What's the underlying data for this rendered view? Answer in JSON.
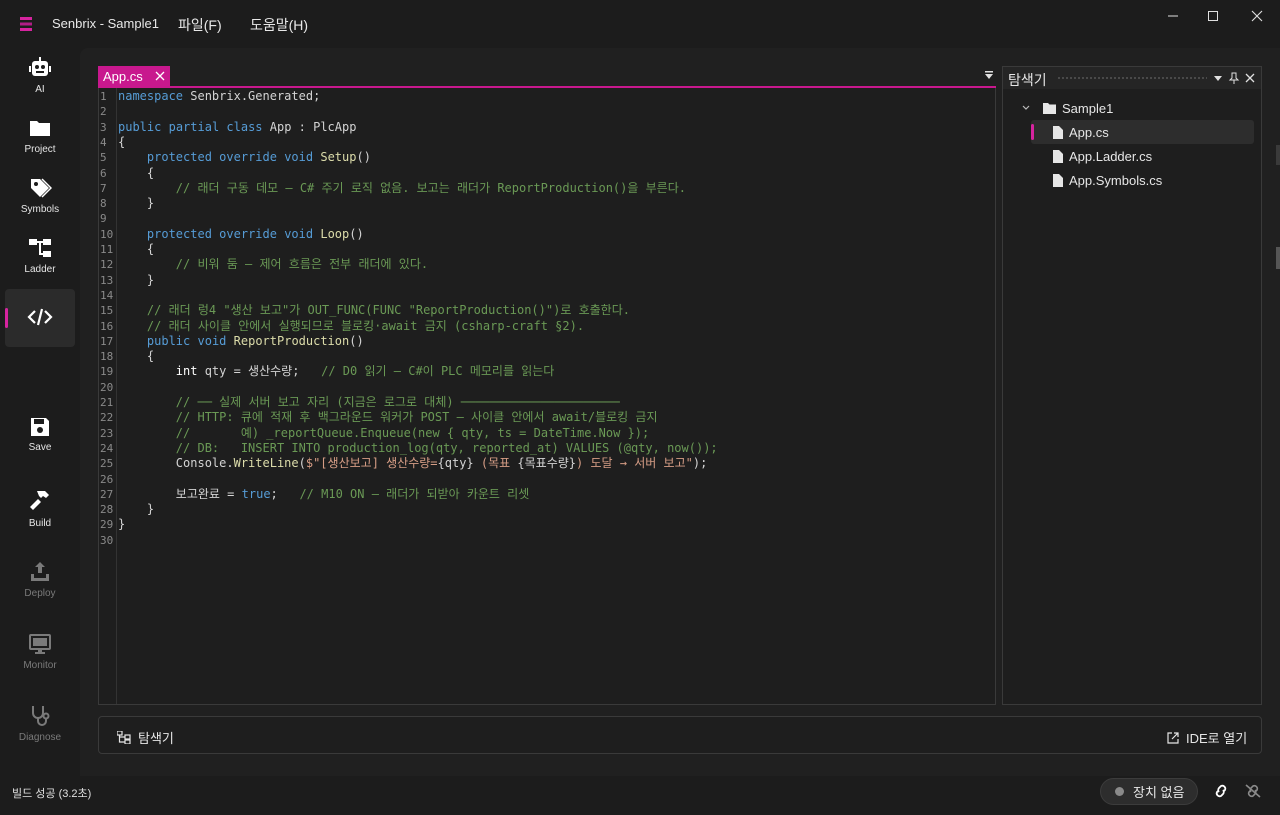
{
  "window": {
    "title": "Senbrix - Sample1",
    "menu": [
      {
        "label": "파일(F)"
      },
      {
        "label": "도움말(H)"
      }
    ],
    "accent": "#d6249f"
  },
  "sidebar": {
    "items": [
      {
        "label": "AI",
        "icon": "robot-icon",
        "enabled": true
      },
      {
        "label": "Project",
        "icon": "folder-icon",
        "enabled": true
      },
      {
        "label": "Symbols",
        "icon": "tag-icon",
        "enabled": true
      },
      {
        "label": "Ladder",
        "icon": "ladder-diagram-icon",
        "enabled": true
      },
      {
        "label": "",
        "icon": "code-icon",
        "enabled": true,
        "active": true
      },
      {
        "label": "Save",
        "icon": "save-icon",
        "enabled": true
      },
      {
        "label": "Build",
        "icon": "hammer-icon",
        "enabled": true
      },
      {
        "label": "Deploy",
        "icon": "upload-icon",
        "enabled": false
      },
      {
        "label": "Monitor",
        "icon": "monitor-icon",
        "enabled": false
      },
      {
        "label": "Diagnose",
        "icon": "stethoscope-icon",
        "enabled": false
      }
    ]
  },
  "editor": {
    "tab_label": "App.cs",
    "lines": [
      "namespace Senbrix.Generated;",
      "",
      "public partial class App : PlcApp",
      "{",
      "    protected override void Setup()",
      "    {",
      "        // 래더 구동 데모 — C# 주기 로직 없음. 보고는 래더가 ReportProduction()을 부른다.",
      "    }",
      "",
      "    protected override void Loop()",
      "    {",
      "        // 비워 둠 — 제어 흐름은 전부 래더에 있다.",
      "    }",
      "",
      "    // 래더 렁4 \"생산 보고\"가 OUT_FUNC(FUNC \"ReportProduction()\")로 호출한다.",
      "    // 래더 사이클 안에서 실행되므로 블로킹·await 금지 (csharp-craft §2).",
      "    public void ReportProduction()",
      "    {",
      "        int qty = 생산수량;   // D0 읽기 — C#이 PLC 메모리를 읽는다",
      "",
      "        // ── 실제 서버 보고 자리 (지금은 로그로 대체) ──────────────────────",
      "        // HTTP: 큐에 적재 후 백그라운드 워커가 POST — 사이클 안에서 await/블로킹 금지",
      "        //       예) _reportQueue.Enqueue(new { qty, ts = DateTime.Now });",
      "        // DB:   INSERT INTO production_log(qty, reported_at) VALUES (@qty, now());",
      "        Console.WriteLine($\"[생산보고] 생산수량={qty} (목표 {목표수량}) 도달 → 서버 보고\");",
      "",
      "        보고완료 = true;   // M10 ON — 래더가 되받아 카운트 리셋",
      "    }",
      "}",
      ""
    ]
  },
  "explorer": {
    "title": "탐색기",
    "root": "Sample1",
    "files": [
      {
        "name": "App.cs",
        "selected": true
      },
      {
        "name": "App.Ladder.cs",
        "selected": false
      },
      {
        "name": "App.Symbols.cs",
        "selected": false
      }
    ]
  },
  "bottombar": {
    "explorer_label": "탐색기",
    "open_ide_label": "IDE로 열기"
  },
  "status": {
    "build_text": "빌드 성공 (3.2초)",
    "device_label": "장치 없음"
  }
}
